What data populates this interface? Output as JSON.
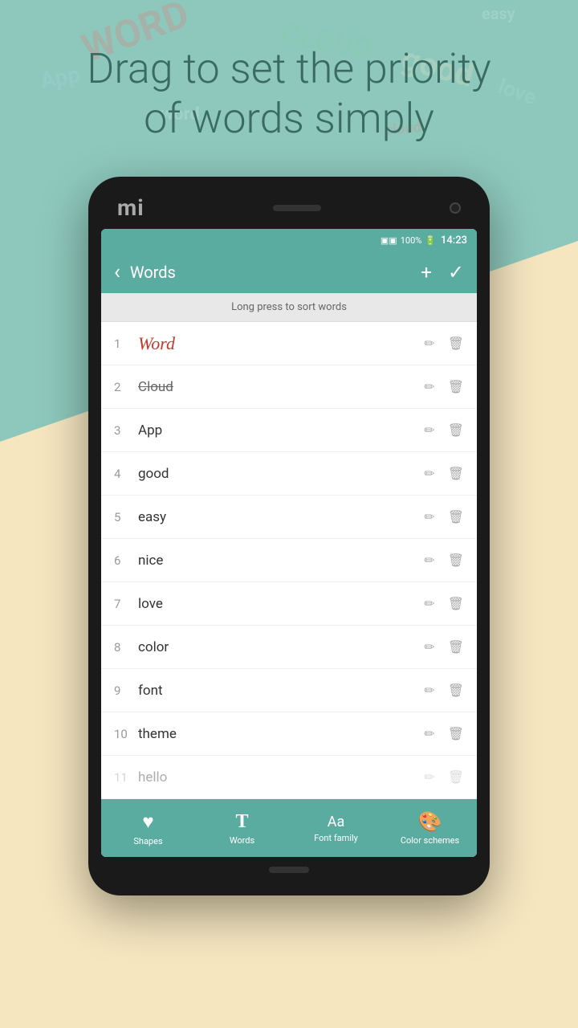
{
  "background": {
    "teal_color": "#8ec8bc",
    "cream_color": "#f5e6c0"
  },
  "hero": {
    "line1": "Drag to set the priority",
    "line2": "of words simply"
  },
  "phone": {
    "brand": "mi",
    "status_bar": {
      "battery": "100%",
      "time": "14:23"
    },
    "header": {
      "back_label": "‹",
      "title": "Words",
      "add_label": "+",
      "check_label": "✓"
    },
    "sort_hint": "Long press to sort words",
    "words": [
      {
        "num": 1,
        "text": "Word",
        "style": "handwritten"
      },
      {
        "num": 2,
        "text": "Cloud",
        "style": "strikethrough"
      },
      {
        "num": 3,
        "text": "App",
        "style": "normal"
      },
      {
        "num": 4,
        "text": "good",
        "style": "normal"
      },
      {
        "num": 5,
        "text": "easy",
        "style": "normal"
      },
      {
        "num": 6,
        "text": "nice",
        "style": "normal"
      },
      {
        "num": 7,
        "text": "love",
        "style": "normal"
      },
      {
        "num": 8,
        "text": "color",
        "style": "normal"
      },
      {
        "num": 9,
        "text": "font",
        "style": "normal"
      },
      {
        "num": 10,
        "text": "theme",
        "style": "normal"
      }
    ],
    "bottom_nav": [
      {
        "id": "shapes",
        "icon": "♥",
        "label": "Shapes"
      },
      {
        "id": "words",
        "icon": "T",
        "label": "Words"
      },
      {
        "id": "font_family",
        "icon": "Aa",
        "label": "Font family"
      },
      {
        "id": "color_schemes",
        "icon": "🎨",
        "label": "Color schemes"
      }
    ]
  }
}
